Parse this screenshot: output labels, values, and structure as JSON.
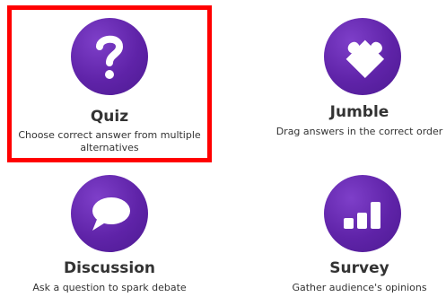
{
  "activities": [
    {
      "id": "quiz",
      "title": "Quiz",
      "description": "Choose correct answer from multiple alternatives",
      "icon": "question-mark-icon",
      "selected": true
    },
    {
      "id": "jumble",
      "title": "Jumble",
      "description": "Drag answers in the correct order",
      "icon": "puzzle-piece-icon",
      "selected": false
    },
    {
      "id": "discussion",
      "title": "Discussion",
      "description": "Ask a question to spark debate",
      "icon": "speech-bubble-icon",
      "selected": false
    },
    {
      "id": "survey",
      "title": "Survey",
      "description": "Gather audience's opinions",
      "icon": "bar-chart-icon",
      "selected": false
    }
  ],
  "colors": {
    "icon_background": "#5f23a8",
    "selection_border": "#ff0000",
    "text": "#333333"
  }
}
